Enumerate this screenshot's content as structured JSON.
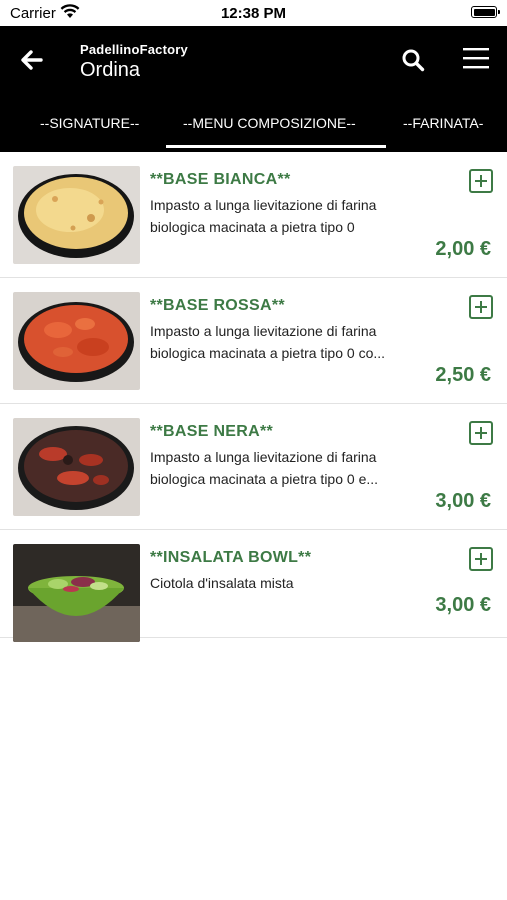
{
  "status_bar": {
    "carrier": "Carrier",
    "time": "12:38 PM"
  },
  "header": {
    "subtitle": "PadellinoFactory",
    "title": "Ordina",
    "icons": [
      "arrow-left-icon",
      "search-icon",
      "hamburger-menu-icon"
    ]
  },
  "tabs": [
    {
      "label": "--SIGNATURE--"
    },
    {
      "label": "--MENU COMPOSIZIONE--",
      "selected": true
    },
    {
      "label": "--FARINATA-"
    }
  ],
  "colors": {
    "accent": "#3d7a45",
    "header_bg": "#000000",
    "text": "#222222"
  },
  "items": [
    {
      "name": "**BASE BIANCA**",
      "desc_line1": "Impasto a lunga lievitazione di farina",
      "desc_line2": "biologica macinata a pietra tipo 0",
      "price": "2,00 €",
      "image": "white-pizza-base"
    },
    {
      "name": "**BASE ROSSA**",
      "desc_line1": "Impasto a lunga lievitazione di farina",
      "desc_line2": "biologica macinata a pietra tipo 0 co...",
      "price": "2,50 €",
      "image": "red-pizza-base"
    },
    {
      "name": "**BASE NERA**",
      "desc_line1": "Impasto a lunga lievitazione di farina",
      "desc_line2": "biologica macinata a pietra tipo 0 e...",
      "price": "3,00 €",
      "image": "black-pizza-base"
    },
    {
      "name": "**INSALATA BOWL**",
      "desc_line1": "Ciotola d'insalata mista",
      "desc_line2": "",
      "price": "3,00 €",
      "image": "salad-bowl"
    }
  ]
}
